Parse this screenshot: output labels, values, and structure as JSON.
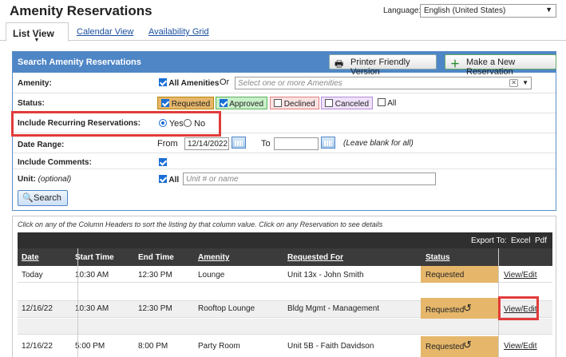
{
  "header": {
    "title": "Amenity Reservations",
    "language_label": "Language:",
    "language_value": "English (United States)"
  },
  "tabs": [
    {
      "label": "List View",
      "active": true
    },
    {
      "label": "Calendar View",
      "active": false
    },
    {
      "label": "Availability Grid",
      "active": false
    }
  ],
  "search": {
    "title": "Search Amenity Reservations",
    "printer_button": "Printer Friendly Version",
    "new_button": "Make a New Reservation",
    "amenity": {
      "label": "Amenity:",
      "all_label": "All Amenities",
      "or_text": "Or",
      "placeholder": "Select one or more Amenities"
    },
    "status": {
      "label": "Status:",
      "options": [
        {
          "label": "Requested",
          "checked": true,
          "bg": "#e6b76b",
          "border": "#b8860b"
        },
        {
          "label": "Approved",
          "checked": true,
          "bg": "#c8f0c8",
          "border": "#5cae5c"
        },
        {
          "label": "Declined",
          "checked": false,
          "bg": "#fbe2e2",
          "border": "#e28080"
        },
        {
          "label": "Canceled",
          "checked": false,
          "bg": "#efe2fb",
          "border": "#b48ad8"
        }
      ],
      "all_label": "All"
    },
    "recurring": {
      "label": "Include Recurring Reservations:",
      "yes": "Yes",
      "no": "No",
      "selected": "Yes"
    },
    "date_range": {
      "label": "Date Range:",
      "from_label": "From",
      "from_value": "12/14/2022",
      "to_label": "To",
      "to_value": "",
      "hint": "(Leave blank for all)"
    },
    "include_comments": {
      "label": "Include Comments:",
      "checked": true
    },
    "unit": {
      "label": "Unit:",
      "optional": "(optional)",
      "all_label": "All",
      "placeholder": "Unit # or name"
    },
    "search_button": "Search"
  },
  "results": {
    "hint": "Click on any of the Column Headers to sort the listing by that column value. Click on any Reservation to see details",
    "export_label": "Export To:",
    "export_excel": "Excel",
    "export_pdf": "Pdf",
    "columns": [
      "Date",
      "Start Time",
      "End Time",
      "Amenity",
      "Requested For",
      "Status"
    ],
    "rows": [
      {
        "date": "Today",
        "start": "10:30 AM",
        "end": "12:30 PM",
        "amenity": "Lounge",
        "for": "Unit 13x - John Smith",
        "status": "Requested",
        "recurring": false,
        "action": "View/Edit"
      },
      {
        "date": "12/16/22",
        "start": "10:30 AM",
        "end": "12:30 PM",
        "amenity": "Rooftop Lounge",
        "for": "Bldg Mgmt - Management",
        "status": "Requested",
        "recurring": true,
        "action": "View/Edit"
      },
      {
        "date": "12/16/22",
        "start": "5:00 PM",
        "end": "8:00 PM",
        "amenity": "Party Room",
        "for": "Unit 5B - Faith Davidson",
        "status": "Requested",
        "recurring": true,
        "action": "View/Edit"
      }
    ]
  },
  "icons": {
    "printer": "printer-icon",
    "plus": "plus-icon",
    "search": "search-icon",
    "calendar": "calendar-icon",
    "recurring": "recurring-icon"
  },
  "colors": {
    "header_blue": "#4f86c6",
    "requested": "#e6b76b",
    "highlight": "#e23b3b"
  }
}
